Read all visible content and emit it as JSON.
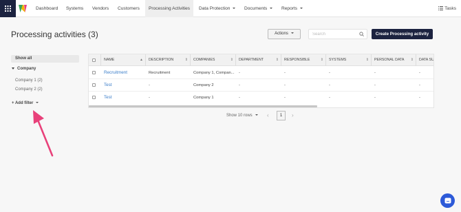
{
  "nav": {
    "items": [
      {
        "label": "Dashboard",
        "dropdown": false,
        "active": false
      },
      {
        "label": "Systems",
        "dropdown": false,
        "active": false
      },
      {
        "label": "Vendors",
        "dropdown": false,
        "active": false
      },
      {
        "label": "Customers",
        "dropdown": false,
        "active": false
      },
      {
        "label": "Processing Activities",
        "dropdown": false,
        "active": true
      },
      {
        "label": "Data Protection",
        "dropdown": true,
        "active": false
      },
      {
        "label": "Documents",
        "dropdown": true,
        "active": false
      },
      {
        "label": "Reports",
        "dropdown": true,
        "active": false
      }
    ],
    "tasks_label": "Tasks"
  },
  "page": {
    "title": "Processing activities (3)",
    "actions_label": "Actions",
    "search_placeholder": "Search",
    "create_label": "Create Processing activity"
  },
  "sidebar": {
    "show_all": "Show all",
    "group_label": "Company",
    "options": [
      "Company 1 (2)",
      "Company 2 (2)"
    ],
    "add_filter": "+ Add filter"
  },
  "table": {
    "columns": [
      "NAME",
      "DESCRIPTION",
      "COMPANIES",
      "DEPARTMENT",
      "RESPONSIBLE",
      "SYSTEMS",
      "PERSONAL DATA",
      "DATA SU"
    ],
    "rows": [
      {
        "name": "Recruitment",
        "description": "Recruitment",
        "companies": "Company 1, Compan...",
        "department": "-",
        "responsible": "-",
        "systems": "-",
        "personal_data": "-",
        "data_su": "-"
      },
      {
        "name": "Test",
        "description": "-",
        "companies": "Company 2",
        "department": "-",
        "responsible": "-",
        "systems": "-",
        "personal_data": "-",
        "data_su": "-"
      },
      {
        "name": "Test",
        "description": "-",
        "companies": "Company 1",
        "department": "-",
        "responsible": "-",
        "systems": "-",
        "personal_data": "-",
        "data_su": "-"
      }
    ]
  },
  "pagination": {
    "rows_label": "Show 10 rows",
    "prev": "‹",
    "current_page": "1",
    "next": "›"
  },
  "colors": {
    "brand_dark": "#1c2340",
    "link": "#3a7dc9",
    "annotation_arrow": "#e8417a",
    "chat_button": "#2d5ad8"
  },
  "icons": [
    "apps-grid-icon",
    "logo-icon",
    "tasks-list-icon",
    "search-icon",
    "sort-up-icon",
    "sort-icon",
    "chat-icon",
    "annotation-arrow"
  ]
}
